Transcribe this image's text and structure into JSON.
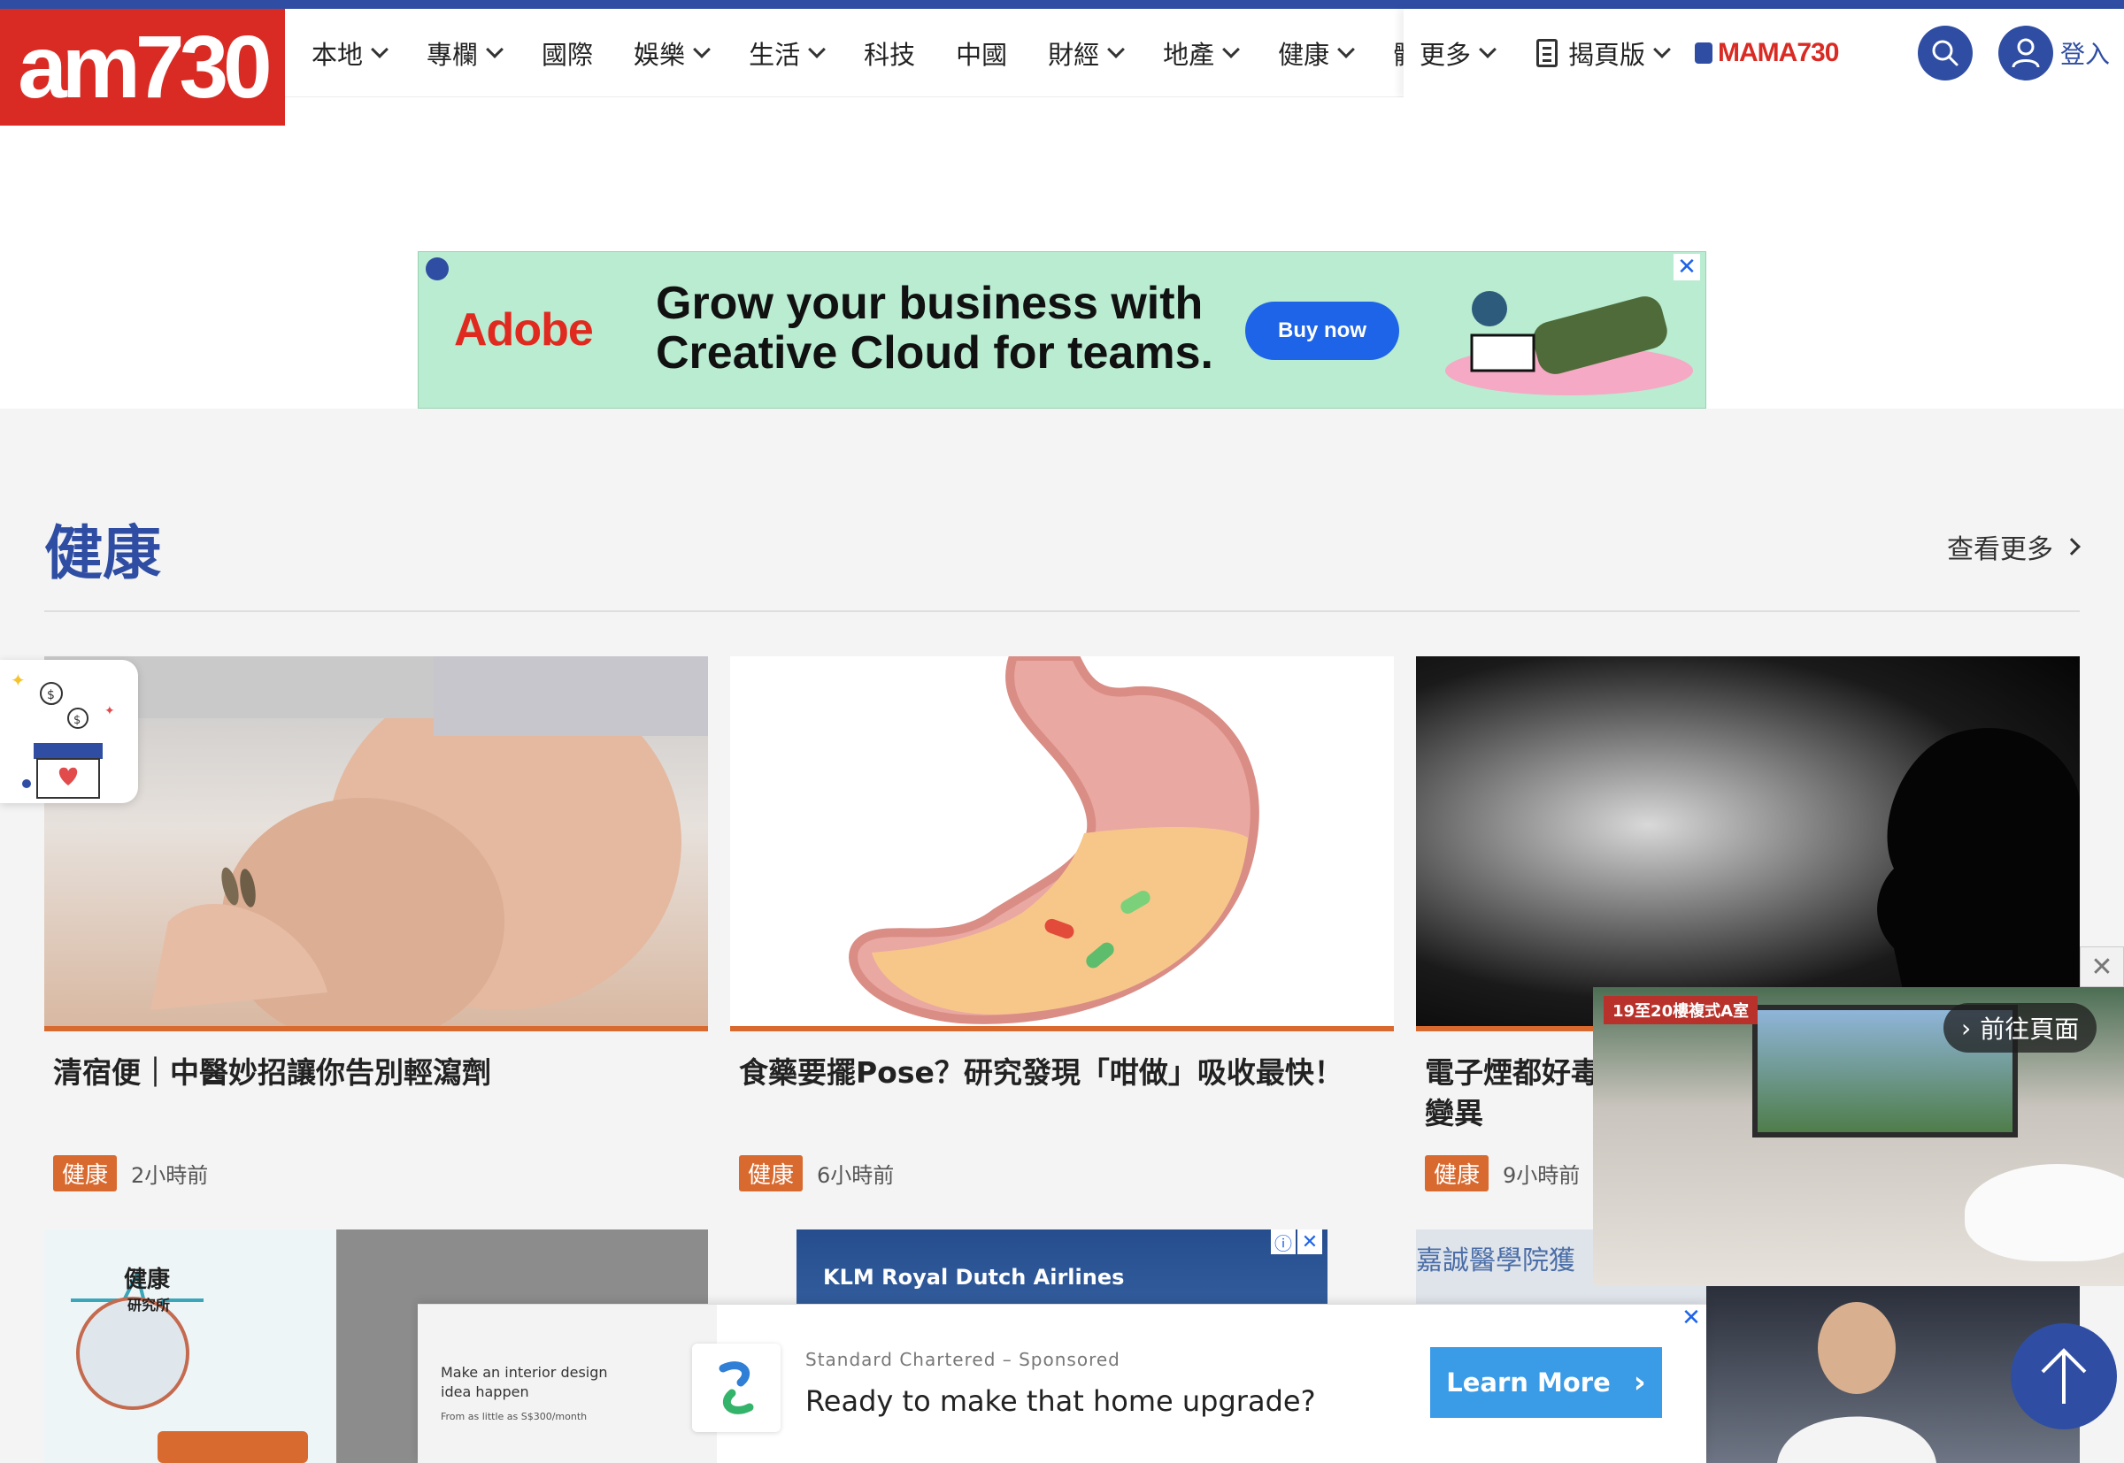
{
  "header": {
    "logo_text": "am730",
    "nav_items": [
      {
        "label": "本地",
        "dropdown": true
      },
      {
        "label": "專欄",
        "dropdown": true
      },
      {
        "label": "國際",
        "dropdown": false
      },
      {
        "label": "娛樂",
        "dropdown": true
      },
      {
        "label": "生活",
        "dropdown": true
      },
      {
        "label": "科技",
        "dropdown": false
      },
      {
        "label": "中國",
        "dropdown": false
      },
      {
        "label": "財經",
        "dropdown": true
      },
      {
        "label": "地產",
        "dropdown": true
      },
      {
        "label": "健康",
        "dropdown": true
      },
      {
        "label": "體",
        "dropdown": false
      }
    ],
    "more_label": "更多",
    "flip_label": "揭頁版",
    "mama_label": "MAMA730",
    "login_label": "登入",
    "brand_color": "#2f4ea3",
    "logo_color": "#d92b24"
  },
  "top_ad": {
    "brand": "Adobe",
    "headline_line1": "Grow your business with",
    "headline_line2": "Creative Cloud for teams.",
    "button": "Buy now"
  },
  "section": {
    "title": "健康",
    "see_more": "查看更多"
  },
  "articles": [
    {
      "title": "清宿便｜中醫妙招讓你告別輕瀉劑",
      "tag": "健康",
      "time": "2小時前"
    },
    {
      "title": "食藥要擺Pose？研究發現「咁做」吸收最快！",
      "tag": "健康",
      "time": "6小時前"
    },
    {
      "title": "電子煙都好毒",
      "title_line2": "變異",
      "tag": "健康",
      "time": "9小時前"
    }
  ],
  "video_overlay": {
    "label": "19至20樓複式A室",
    "goto": "前往頁面"
  },
  "row2": {
    "health_lab_line1": "健康",
    "health_lab_line2": "研究所",
    "klm_text": "KLM Royal Dutch Airlines",
    "third_text": "嘉誠醫學院獲"
  },
  "bottom_ad": {
    "thumb_text": "Make an interior design idea happen",
    "thumb_price": "From as little as S$300/month",
    "sponsor": "Standard Chartered – Sponsored",
    "headline": "Ready to make that home upgrade?",
    "button": "Learn More"
  },
  "accent_color": "#d96a2f"
}
